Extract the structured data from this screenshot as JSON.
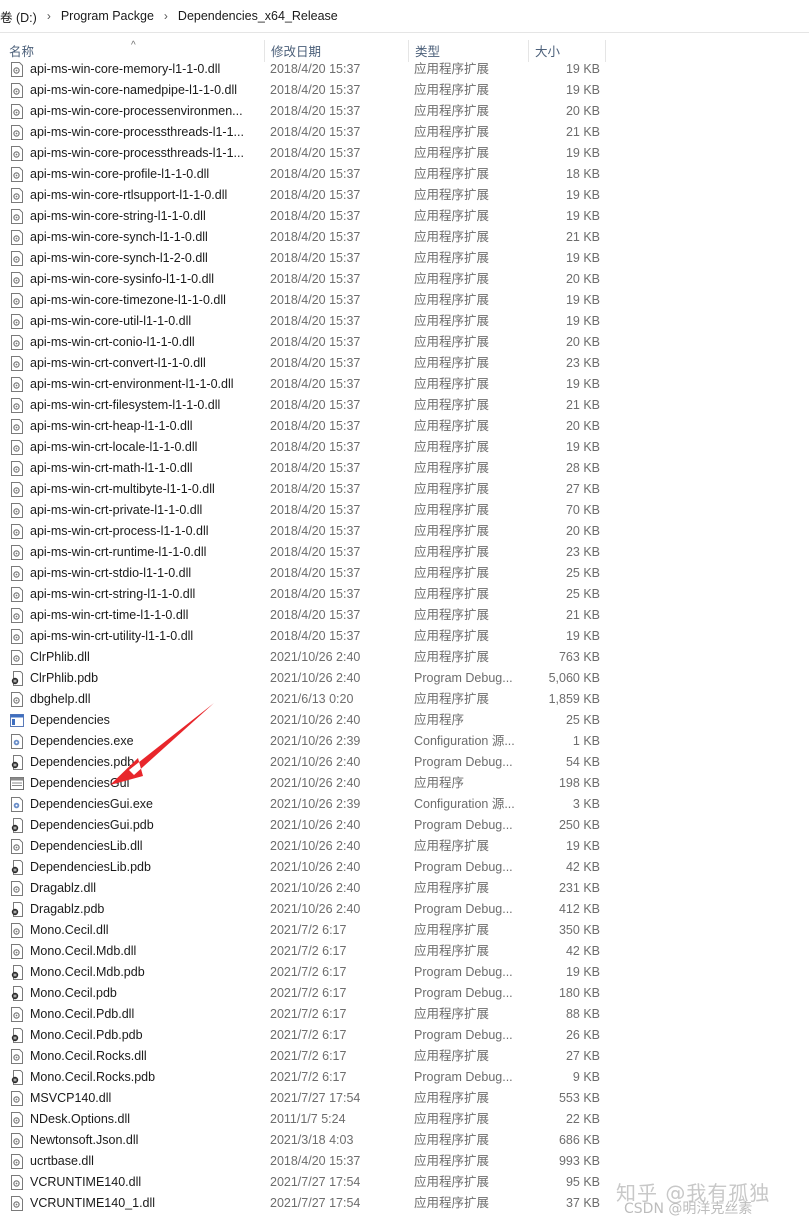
{
  "breadcrumb": [
    "卷 (D:)",
    "Program Packge",
    "Dependencies_x64_Release"
  ],
  "columns": {
    "name": "名称",
    "date": "修改日期",
    "type": "类型",
    "size": "大小"
  },
  "sort_indicator": "^",
  "files": [
    {
      "name": "api-ms-win-core-memory-l1-1-0.dll",
      "date": "2018/4/20 15:37",
      "type": "应用程序扩展",
      "size": "19 KB",
      "icon": "dll-file-icon"
    },
    {
      "name": "api-ms-win-core-namedpipe-l1-1-0.dll",
      "date": "2018/4/20 15:37",
      "type": "应用程序扩展",
      "size": "19 KB",
      "icon": "dll-file-icon"
    },
    {
      "name": "api-ms-win-core-processenvironmen...",
      "date": "2018/4/20 15:37",
      "type": "应用程序扩展",
      "size": "20 KB",
      "icon": "dll-file-icon"
    },
    {
      "name": "api-ms-win-core-processthreads-l1-1...",
      "date": "2018/4/20 15:37",
      "type": "应用程序扩展",
      "size": "21 KB",
      "icon": "dll-file-icon"
    },
    {
      "name": "api-ms-win-core-processthreads-l1-1...",
      "date": "2018/4/20 15:37",
      "type": "应用程序扩展",
      "size": "19 KB",
      "icon": "dll-file-icon"
    },
    {
      "name": "api-ms-win-core-profile-l1-1-0.dll",
      "date": "2018/4/20 15:37",
      "type": "应用程序扩展",
      "size": "18 KB",
      "icon": "dll-file-icon"
    },
    {
      "name": "api-ms-win-core-rtlsupport-l1-1-0.dll",
      "date": "2018/4/20 15:37",
      "type": "应用程序扩展",
      "size": "19 KB",
      "icon": "dll-file-icon"
    },
    {
      "name": "api-ms-win-core-string-l1-1-0.dll",
      "date": "2018/4/20 15:37",
      "type": "应用程序扩展",
      "size": "19 KB",
      "icon": "dll-file-icon"
    },
    {
      "name": "api-ms-win-core-synch-l1-1-0.dll",
      "date": "2018/4/20 15:37",
      "type": "应用程序扩展",
      "size": "21 KB",
      "icon": "dll-file-icon"
    },
    {
      "name": "api-ms-win-core-synch-l1-2-0.dll",
      "date": "2018/4/20 15:37",
      "type": "应用程序扩展",
      "size": "19 KB",
      "icon": "dll-file-icon"
    },
    {
      "name": "api-ms-win-core-sysinfo-l1-1-0.dll",
      "date": "2018/4/20 15:37",
      "type": "应用程序扩展",
      "size": "20 KB",
      "icon": "dll-file-icon"
    },
    {
      "name": "api-ms-win-core-timezone-l1-1-0.dll",
      "date": "2018/4/20 15:37",
      "type": "应用程序扩展",
      "size": "19 KB",
      "icon": "dll-file-icon"
    },
    {
      "name": "api-ms-win-core-util-l1-1-0.dll",
      "date": "2018/4/20 15:37",
      "type": "应用程序扩展",
      "size": "19 KB",
      "icon": "dll-file-icon"
    },
    {
      "name": "api-ms-win-crt-conio-l1-1-0.dll",
      "date": "2018/4/20 15:37",
      "type": "应用程序扩展",
      "size": "20 KB",
      "icon": "dll-file-icon"
    },
    {
      "name": "api-ms-win-crt-convert-l1-1-0.dll",
      "date": "2018/4/20 15:37",
      "type": "应用程序扩展",
      "size": "23 KB",
      "icon": "dll-file-icon"
    },
    {
      "name": "api-ms-win-crt-environment-l1-1-0.dll",
      "date": "2018/4/20 15:37",
      "type": "应用程序扩展",
      "size": "19 KB",
      "icon": "dll-file-icon"
    },
    {
      "name": "api-ms-win-crt-filesystem-l1-1-0.dll",
      "date": "2018/4/20 15:37",
      "type": "应用程序扩展",
      "size": "21 KB",
      "icon": "dll-file-icon"
    },
    {
      "name": "api-ms-win-crt-heap-l1-1-0.dll",
      "date": "2018/4/20 15:37",
      "type": "应用程序扩展",
      "size": "20 KB",
      "icon": "dll-file-icon"
    },
    {
      "name": "api-ms-win-crt-locale-l1-1-0.dll",
      "date": "2018/4/20 15:37",
      "type": "应用程序扩展",
      "size": "19 KB",
      "icon": "dll-file-icon"
    },
    {
      "name": "api-ms-win-crt-math-l1-1-0.dll",
      "date": "2018/4/20 15:37",
      "type": "应用程序扩展",
      "size": "28 KB",
      "icon": "dll-file-icon"
    },
    {
      "name": "api-ms-win-crt-multibyte-l1-1-0.dll",
      "date": "2018/4/20 15:37",
      "type": "应用程序扩展",
      "size": "27 KB",
      "icon": "dll-file-icon"
    },
    {
      "name": "api-ms-win-crt-private-l1-1-0.dll",
      "date": "2018/4/20 15:37",
      "type": "应用程序扩展",
      "size": "70 KB",
      "icon": "dll-file-icon"
    },
    {
      "name": "api-ms-win-crt-process-l1-1-0.dll",
      "date": "2018/4/20 15:37",
      "type": "应用程序扩展",
      "size": "20 KB",
      "icon": "dll-file-icon"
    },
    {
      "name": "api-ms-win-crt-runtime-l1-1-0.dll",
      "date": "2018/4/20 15:37",
      "type": "应用程序扩展",
      "size": "23 KB",
      "icon": "dll-file-icon"
    },
    {
      "name": "api-ms-win-crt-stdio-l1-1-0.dll",
      "date": "2018/4/20 15:37",
      "type": "应用程序扩展",
      "size": "25 KB",
      "icon": "dll-file-icon"
    },
    {
      "name": "api-ms-win-crt-string-l1-1-0.dll",
      "date": "2018/4/20 15:37",
      "type": "应用程序扩展",
      "size": "25 KB",
      "icon": "dll-file-icon"
    },
    {
      "name": "api-ms-win-crt-time-l1-1-0.dll",
      "date": "2018/4/20 15:37",
      "type": "应用程序扩展",
      "size": "21 KB",
      "icon": "dll-file-icon"
    },
    {
      "name": "api-ms-win-crt-utility-l1-1-0.dll",
      "date": "2018/4/20 15:37",
      "type": "应用程序扩展",
      "size": "19 KB",
      "icon": "dll-file-icon"
    },
    {
      "name": "ClrPhlib.dll",
      "date": "2021/10/26 2:40",
      "type": "应用程序扩展",
      "size": "763 KB",
      "icon": "dll-file-icon"
    },
    {
      "name": "ClrPhlib.pdb",
      "date": "2021/10/26 2:40",
      "type": "Program Debug...",
      "size": "5,060 KB",
      "icon": "pdb-file-icon"
    },
    {
      "name": "dbghelp.dll",
      "date": "2021/6/13 0:20",
      "type": "应用程序扩展",
      "size": "1,859 KB",
      "icon": "dll-file-icon"
    },
    {
      "name": "Dependencies",
      "date": "2021/10/26 2:40",
      "type": "应用程序",
      "size": "25 KB",
      "icon": "console-app-icon"
    },
    {
      "name": "Dependencies.exe",
      "date": "2021/10/26 2:39",
      "type": "Configuration 源...",
      "size": "1 KB",
      "icon": "config-file-icon"
    },
    {
      "name": "Dependencies.pdb",
      "date": "2021/10/26 2:40",
      "type": "Program Debug...",
      "size": "54 KB",
      "icon": "pdb-file-icon"
    },
    {
      "name": "DependenciesGui",
      "date": "2021/10/26 2:40",
      "type": "应用程序",
      "size": "198 KB",
      "icon": "window-app-icon"
    },
    {
      "name": "DependenciesGui.exe",
      "date": "2021/10/26 2:39",
      "type": "Configuration 源...",
      "size": "3 KB",
      "icon": "config-file-icon"
    },
    {
      "name": "DependenciesGui.pdb",
      "date": "2021/10/26 2:40",
      "type": "Program Debug...",
      "size": "250 KB",
      "icon": "pdb-file-icon"
    },
    {
      "name": "DependenciesLib.dll",
      "date": "2021/10/26 2:40",
      "type": "应用程序扩展",
      "size": "19 KB",
      "icon": "dll-file-icon"
    },
    {
      "name": "DependenciesLib.pdb",
      "date": "2021/10/26 2:40",
      "type": "Program Debug...",
      "size": "42 KB",
      "icon": "pdb-file-icon"
    },
    {
      "name": "Dragablz.dll",
      "date": "2021/10/26 2:40",
      "type": "应用程序扩展",
      "size": "231 KB",
      "icon": "dll-file-icon"
    },
    {
      "name": "Dragablz.pdb",
      "date": "2021/10/26 2:40",
      "type": "Program Debug...",
      "size": "412 KB",
      "icon": "pdb-file-icon"
    },
    {
      "name": "Mono.Cecil.dll",
      "date": "2021/7/2 6:17",
      "type": "应用程序扩展",
      "size": "350 KB",
      "icon": "dll-file-icon"
    },
    {
      "name": "Mono.Cecil.Mdb.dll",
      "date": "2021/7/2 6:17",
      "type": "应用程序扩展",
      "size": "42 KB",
      "icon": "dll-file-icon"
    },
    {
      "name": "Mono.Cecil.Mdb.pdb",
      "date": "2021/7/2 6:17",
      "type": "Program Debug...",
      "size": "19 KB",
      "icon": "pdb-file-icon"
    },
    {
      "name": "Mono.Cecil.pdb",
      "date": "2021/7/2 6:17",
      "type": "Program Debug...",
      "size": "180 KB",
      "icon": "pdb-file-icon"
    },
    {
      "name": "Mono.Cecil.Pdb.dll",
      "date": "2021/7/2 6:17",
      "type": "应用程序扩展",
      "size": "88 KB",
      "icon": "dll-file-icon"
    },
    {
      "name": "Mono.Cecil.Pdb.pdb",
      "date": "2021/7/2 6:17",
      "type": "Program Debug...",
      "size": "26 KB",
      "icon": "pdb-file-icon"
    },
    {
      "name": "Mono.Cecil.Rocks.dll",
      "date": "2021/7/2 6:17",
      "type": "应用程序扩展",
      "size": "27 KB",
      "icon": "dll-file-icon"
    },
    {
      "name": "Mono.Cecil.Rocks.pdb",
      "date": "2021/7/2 6:17",
      "type": "Program Debug...",
      "size": "9 KB",
      "icon": "pdb-file-icon"
    },
    {
      "name": "MSVCP140.dll",
      "date": "2021/7/27 17:54",
      "type": "应用程序扩展",
      "size": "553 KB",
      "icon": "dll-file-icon"
    },
    {
      "name": "NDesk.Options.dll",
      "date": "2011/1/7 5:24",
      "type": "应用程序扩展",
      "size": "22 KB",
      "icon": "dll-file-icon"
    },
    {
      "name": "Newtonsoft.Json.dll",
      "date": "2021/3/18 4:03",
      "type": "应用程序扩展",
      "size": "686 KB",
      "icon": "dll-file-icon"
    },
    {
      "name": "ucrtbase.dll",
      "date": "2018/4/20 15:37",
      "type": "应用程序扩展",
      "size": "993 KB",
      "icon": "dll-file-icon"
    },
    {
      "name": "VCRUNTIME140.dll",
      "date": "2021/7/27 17:54",
      "type": "应用程序扩展",
      "size": "95 KB",
      "icon": "dll-file-icon"
    },
    {
      "name": "VCRUNTIME140_1.dll",
      "date": "2021/7/27 17:54",
      "type": "应用程序扩展",
      "size": "37 KB",
      "icon": "dll-file-icon"
    }
  ],
  "annotation": {
    "color": "#e8262b",
    "points_to": "DependenciesGui"
  },
  "watermark": {
    "line1": "知乎 @我有孤独",
    "line2": "CSDN @明洋克丝素"
  }
}
